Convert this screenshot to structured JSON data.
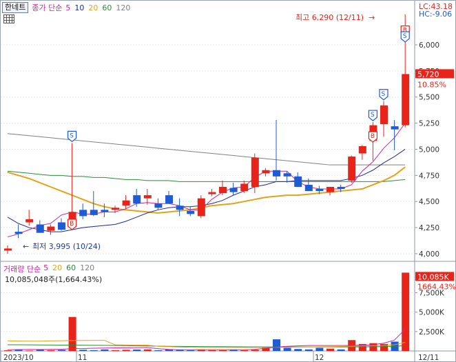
{
  "header": {
    "stock_name": "한네트",
    "ma_title": "종가 단순",
    "ma_periods": [
      {
        "label": "5",
        "color": "#c8289a"
      },
      {
        "label": "10",
        "color": "#1e2a90"
      },
      {
        "label": "20",
        "color": "#e2a21a"
      },
      {
        "label": "60",
        "color": "#2e8b3a"
      },
      {
        "label": "120",
        "color": "#808080"
      }
    ]
  },
  "corner": {
    "lc": "LC:43.18",
    "hc": "HC:-9.06"
  },
  "price_panel": {
    "y_ticks": [
      "6,000",
      "5,750",
      "5,500",
      "5,250",
      "5,000",
      "4,750",
      "4,500",
      "4,250",
      "4,000"
    ],
    "current_price": "5,720",
    "current_change": "10.85%",
    "high_label": "최고 6,290 (12/11)",
    "low_label": "최저 3,995 (10/24)",
    "high_arrow": "→",
    "low_arrow": "←",
    "buy_marker": "B",
    "sell_marker": "S"
  },
  "volume_panel": {
    "title": "거래량 단순",
    "ma_periods": [
      {
        "label": "5",
        "color": "#c8289a"
      },
      {
        "label": "20",
        "color": "#e2a21a"
      },
      {
        "label": "60",
        "color": "#2e8b3a"
      },
      {
        "label": "120",
        "color": "#808080"
      }
    ],
    "info": "10,085,048주(1,664.43%)",
    "y_ticks": [
      "7,500K",
      "5,000K",
      "2,500K"
    ],
    "current_volume": "10,085K",
    "current_change": "1664.43%"
  },
  "x_axis": {
    "labels": [
      "2023/10",
      "11",
      "12",
      "12/11"
    ]
  },
  "colors": {
    "up": "#e8231a",
    "down": "#1e5bd6",
    "ma5": "#c8289a",
    "ma10": "#1e2a90",
    "ma20": "#e2a21a",
    "ma60": "#2e8b3a",
    "ma120": "#808080",
    "high": "#e8231a",
    "low": "#1e3a9a"
  },
  "chart_data": {
    "type": "candlestick",
    "ohlc": [
      [
        4030,
        4080,
        4000,
        4050
      ],
      [
        4210,
        4280,
        4150,
        4190
      ],
      [
        4300,
        4420,
        4270,
        4330
      ],
      [
        4280,
        4320,
        4200,
        4200
      ],
      [
        4220,
        4280,
        4180,
        4260
      ],
      [
        4300,
        4340,
        4220,
        4230
      ],
      [
        4300,
        5060,
        4250,
        4400
      ],
      [
        4420,
        4480,
        4330,
        4360
      ],
      [
        4420,
        4600,
        4360,
        4370
      ],
      [
        4420,
        4480,
        4350,
        4400
      ],
      [
        4420,
        4460,
        4390,
        4440
      ],
      [
        4460,
        4560,
        4430,
        4510
      ],
      [
        4560,
        4620,
        4450,
        4480
      ],
      [
        4530,
        4620,
        4470,
        4560
      ],
      [
        4480,
        4530,
        4420,
        4440
      ],
      [
        4560,
        4600,
        4480,
        4480
      ],
      [
        4460,
        4530,
        4360,
        4420
      ],
      [
        4410,
        4450,
        4360,
        4380
      ],
      [
        4360,
        4560,
        4340,
        4530
      ],
      [
        4570,
        4620,
        4550,
        4590
      ],
      [
        4580,
        4700,
        4560,
        4640
      ],
      [
        4630,
        4680,
        4560,
        4590
      ],
      [
        4600,
        4700,
        4580,
        4670
      ],
      [
        4640,
        4960,
        4580,
        4920
      ],
      [
        4770,
        4820,
        4740,
        4800
      ],
      [
        4800,
        5280,
        4700,
        4740
      ],
      [
        4770,
        4790,
        4680,
        4740
      ],
      [
        4740,
        4780,
        4640,
        4640
      ],
      [
        4660,
        4720,
        4600,
        4600
      ],
      [
        4620,
        4650,
        4570,
        4600
      ],
      [
        4590,
        4640,
        4560,
        4640
      ],
      [
        4640,
        4660,
        4590,
        4620
      ],
      [
        4700,
        4940,
        4680,
        4930
      ],
      [
        4960,
        5040,
        4900,
        5030
      ],
      [
        5080,
        5260,
        4890,
        5230
      ],
      [
        5240,
        5460,
        5120,
        5420
      ],
      [
        5220,
        5280,
        4990,
        5190
      ],
      [
        5230,
        6290,
        5210,
        5720
      ]
    ],
    "ma5": [
      4160,
      4190,
      4230,
      4270,
      4290,
      4370,
      4400,
      4380,
      4380,
      4400,
      4400,
      4430,
      4480,
      4490,
      4480,
      4480,
      4460,
      4420,
      4420,
      4520,
      4590,
      4630,
      4640,
      4730,
      4790,
      4790,
      4790,
      4690,
      4640,
      4620,
      4620,
      4620,
      4660,
      4790,
      4880,
      5010,
      5110,
      5250
    ],
    "ma10": [
      4350,
      4290,
      4250,
      4230,
      4210,
      4210,
      4230,
      4250,
      4260,
      4270,
      4280,
      4310,
      4350,
      4390,
      4420,
      4440,
      4450,
      4450,
      4460,
      4480,
      4510,
      4560,
      4600,
      4640,
      4660,
      4690,
      4690,
      4700,
      4700,
      4700,
      4700,
      4700,
      4720,
      4750,
      4800,
      4870,
      4930,
      5000
    ],
    "ma20": [
      4780,
      4750,
      4720,
      4680,
      4640,
      4600,
      4560,
      4520,
      4480,
      4450,
      4430,
      4420,
      4410,
      4400,
      4390,
      4400,
      4410,
      4420,
      4440,
      4460,
      4470,
      4480,
      4500,
      4520,
      4540,
      4550,
      4560,
      4560,
      4570,
      4580,
      4590,
      4600,
      4610,
      4620,
      4660,
      4700,
      4750,
      4830
    ],
    "ma60": [
      4790,
      4780,
      4770,
      4760,
      4750,
      4750,
      4740,
      4740,
      4730,
      4730,
      4720,
      4710,
      4710,
      4700,
      4700,
      4700,
      4690,
      4690,
      4690,
      4690,
      4690,
      4690,
      4690,
      4690,
      4690,
      4690,
      4690,
      4690,
      4690,
      4690,
      4690,
      4690,
      4690,
      4690,
      4690,
      4690,
      4700,
      4710
    ],
    "ma120": [
      5150,
      5140,
      5130,
      5120,
      5110,
      5100,
      5090,
      5080,
      5070,
      5060,
      5050,
      5040,
      5030,
      5020,
      5010,
      5000,
      4990,
      4980,
      4970,
      4960,
      4950,
      4940,
      4930,
      4920,
      4910,
      4900,
      4890,
      4880,
      4870,
      4860,
      4850,
      4850,
      4850,
      4850,
      4850,
      4850,
      4850,
      4850
    ],
    "volume": [
      80,
      140,
      60,
      200,
      100,
      150,
      4380,
      150,
      100,
      200,
      100,
      150,
      180,
      200,
      100,
      200,
      150,
      100,
      150,
      100,
      100,
      150,
      100,
      150,
      400,
      1500,
      400,
      250,
      200,
      400,
      300,
      200,
      1400,
      900,
      1000,
      900,
      1200,
      10085
    ],
    "vol_ma5": [
      150,
      180,
      200,
      190,
      210,
      220,
      300,
      310,
      360,
      380,
      400,
      400,
      420,
      440,
      300,
      200,
      150,
      150,
      160,
      150,
      150,
      150,
      160,
      200,
      350,
      500,
      600,
      650,
      700,
      700,
      700,
      700,
      700,
      750,
      800,
      1000,
      1400,
      2800
    ],
    "vol_ma20": [
      1300,
      1280,
      1270,
      1270,
      1300,
      1320,
      1340,
      1350,
      1360,
      1370,
      800,
      780,
      770,
      760,
      600,
      550,
      500,
      480,
      460,
      450,
      450,
      450,
      450,
      450,
      450,
      470,
      480,
      500,
      520,
      540,
      560,
      580,
      600,
      640,
      680,
      700,
      800,
      1100
    ],
    "vol_ma60": [
      800,
      800,
      790,
      780,
      770,
      760,
      750,
      740,
      730,
      720,
      700,
      680,
      660,
      640,
      620,
      600,
      590,
      580,
      570,
      560,
      550,
      540,
      530,
      520,
      520,
      520,
      520,
      520,
      520,
      520,
      520,
      520,
      520,
      520,
      540,
      560,
      580,
      700
    ],
    "buy_signals": [
      6,
      34,
      37
    ],
    "sell_signals": [
      6,
      34,
      35,
      37
    ],
    "price_ylim": [
      3960,
      6330
    ],
    "volume_ylim": [
      0,
      10300
    ]
  }
}
